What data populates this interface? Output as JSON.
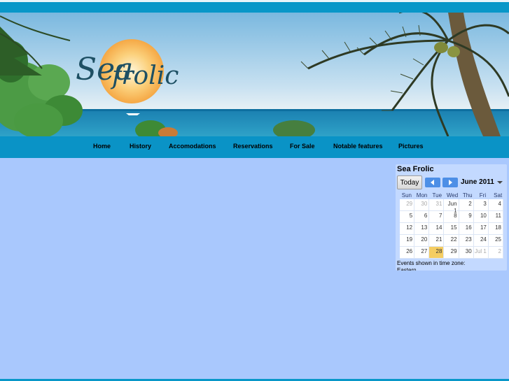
{
  "brand": {
    "logo_text_1": "Sea",
    "logo_text_2": "frolic"
  },
  "nav": {
    "items": [
      {
        "label": "Home"
      },
      {
        "label": "History"
      },
      {
        "label": "Accomodations"
      },
      {
        "label": "Reservations"
      },
      {
        "label": "For Sale"
      },
      {
        "label": "Notable features"
      },
      {
        "label": "Pictures"
      }
    ]
  },
  "calendar": {
    "title": "Sea Frolic",
    "today_label": "Today",
    "prev_icon": "left-arrow-icon",
    "next_icon": "right-arrow-icon",
    "month_label": "June 2011",
    "weekdays": [
      "Sun",
      "Mon",
      "Tue",
      "Wed",
      "Thu",
      "Fri",
      "Sat"
    ],
    "weeks": [
      [
        "29",
        "30",
        "31",
        "Jun 1",
        "2",
        "3",
        "4"
      ],
      [
        "5",
        "6",
        "7",
        "8",
        "9",
        "10",
        "11"
      ],
      [
        "12",
        "13",
        "14",
        "15",
        "16",
        "17",
        "18"
      ],
      [
        "19",
        "20",
        "21",
        "22",
        "23",
        "24",
        "25"
      ],
      [
        "26",
        "27",
        "28",
        "29",
        "30",
        "Jul 1",
        "2"
      ]
    ],
    "footer": "Events shown in time zone: Eastern"
  },
  "colors": {
    "accent": "#0a93c6",
    "page_bg": "#a9c8fd",
    "today": "#f5cd62"
  }
}
